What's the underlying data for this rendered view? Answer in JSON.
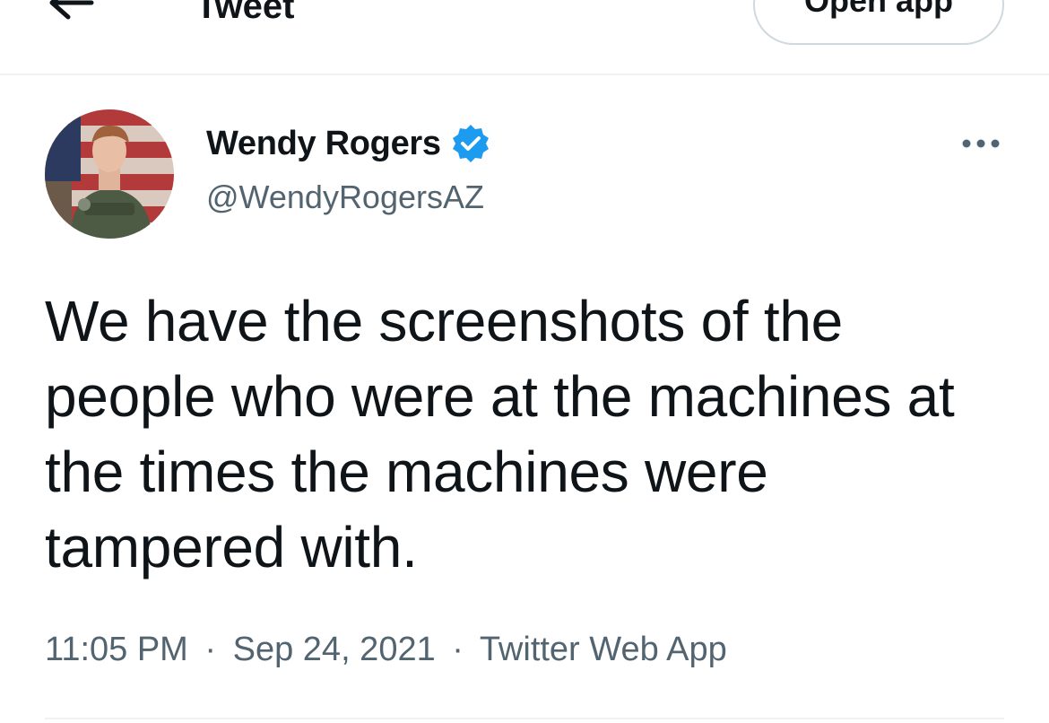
{
  "header": {
    "title": "Tweet",
    "open_app_label": "Open app"
  },
  "tweet": {
    "author_name": "Wendy Rogers",
    "author_handle": "@WendyRogersAZ",
    "verified": true,
    "text": "We have the screenshots of the people who were at the machines at the times the machines were tampered with.",
    "time": "11:05 PM",
    "date": "Sep 24, 2021",
    "source": "Twitter Web App",
    "separator": "·"
  },
  "icons": {
    "back": "back-arrow-icon",
    "verified": "verified-badge-icon",
    "more": "more-options-icon"
  },
  "colors": {
    "text_primary": "#0f1419",
    "text_secondary": "#536471",
    "verified_blue": "#1d9bf0",
    "divider": "#eff3f4",
    "button_border": "#cfd9de"
  }
}
